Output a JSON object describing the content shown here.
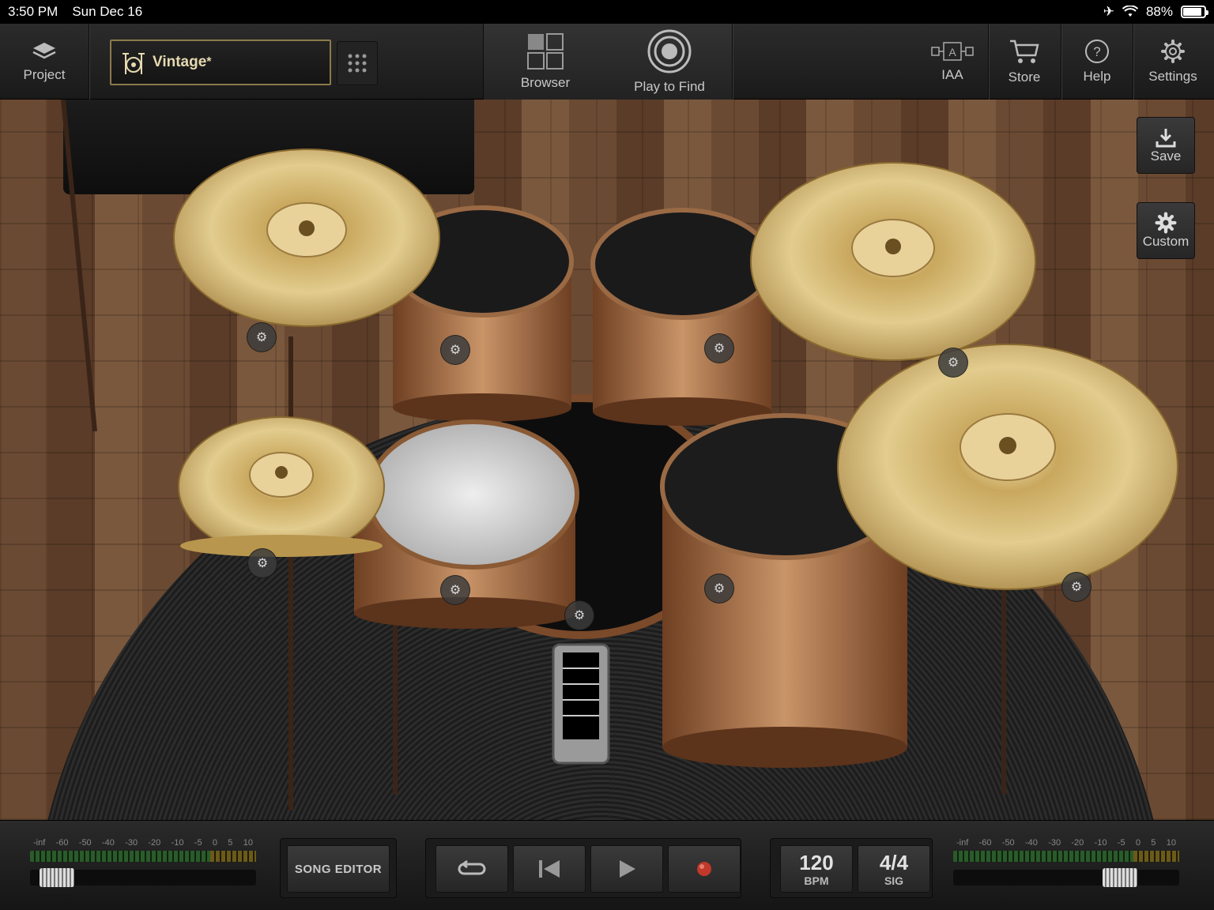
{
  "status": {
    "time": "3:50 PM",
    "date": "Sun Dec 16",
    "battery": "88%",
    "battery_level": 0.88
  },
  "toolbar": {
    "project_label": "Project",
    "preset_name": "Vintage",
    "preset_modified_mark": "*",
    "browser_label": "Browser",
    "play_to_find_label": "Play to Find",
    "iaa_label": "IAA",
    "store_label": "Store",
    "help_label": "Help",
    "settings_label": "Settings"
  },
  "side": {
    "save_label": "Save",
    "custom_label": "Custom"
  },
  "bottom": {
    "meter_scale": [
      "-inf",
      "-60",
      "-50",
      "-40",
      "-30",
      "-20",
      "-10",
      "-5",
      "0",
      "5",
      "10"
    ],
    "left_fader_level": 0.05,
    "right_fader_level": 0.78,
    "song_editor_label": "SONG EDITOR",
    "tempo_value": "120",
    "tempo_unit": "BPM",
    "sig_value": "4/4",
    "sig_unit": "SIG"
  },
  "icons": {
    "project": "layers-icon",
    "preset": "drum-kit-icon",
    "grid": "grid-icon",
    "browser": "browser-grid-icon",
    "play_to_find": "target-icon",
    "iaa": "iaa-icon",
    "store": "cart-icon",
    "help": "help-icon",
    "settings": "gear-icon",
    "save": "download-icon",
    "custom": "gear-icon",
    "loop": "loop-icon",
    "rewind": "rewind-icon",
    "play": "play-icon",
    "record": "record-icon"
  },
  "colors": {
    "accent": "#8c7a4a",
    "record": "#c0392b",
    "meter_green": "#2a5b2a"
  }
}
